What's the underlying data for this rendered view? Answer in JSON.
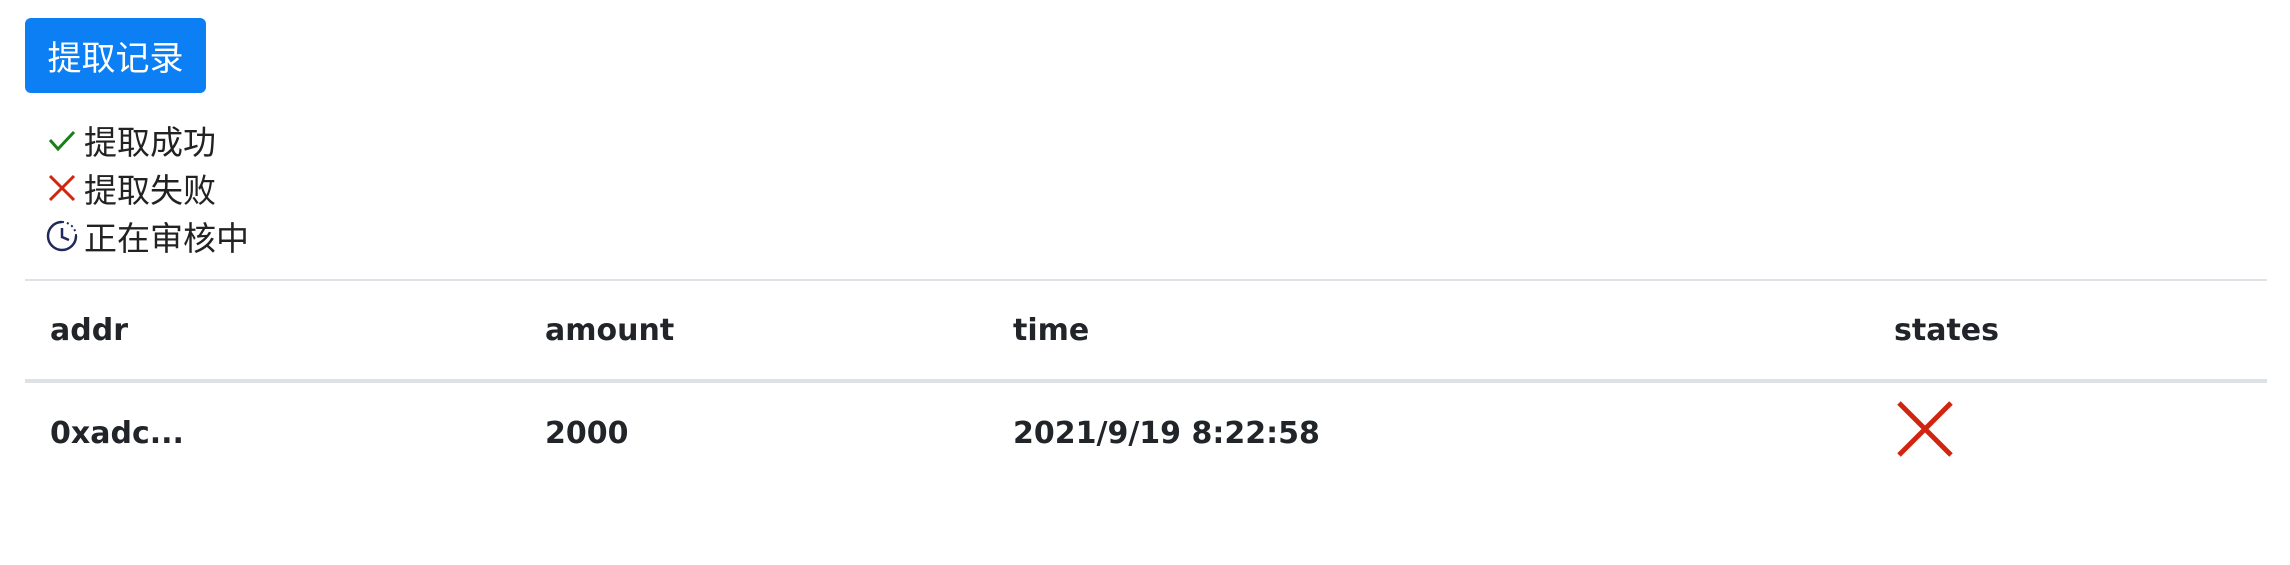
{
  "button": {
    "label": "提取记录"
  },
  "legend": [
    {
      "icon": "check-icon",
      "label": "提取成功",
      "color": "#1a7f1a"
    },
    {
      "icon": "cross-icon",
      "label": "提取失败",
      "color": "#d0250f"
    },
    {
      "icon": "clock-icon",
      "label": "正在审核中",
      "color": "#1f2a5a"
    }
  ],
  "table": {
    "headers": {
      "addr": "addr",
      "amount": "amount",
      "time": "time",
      "states": "states"
    },
    "rows": [
      {
        "addr": "0xadc...",
        "amount": "2000",
        "time": "2021/9/19 8:22:58",
        "state_icon": "cross-icon"
      }
    ]
  },
  "colors": {
    "primary": "#0d7ff5",
    "fail": "#d0250f",
    "success": "#1a7f1a",
    "pending": "#1f2a5a"
  }
}
